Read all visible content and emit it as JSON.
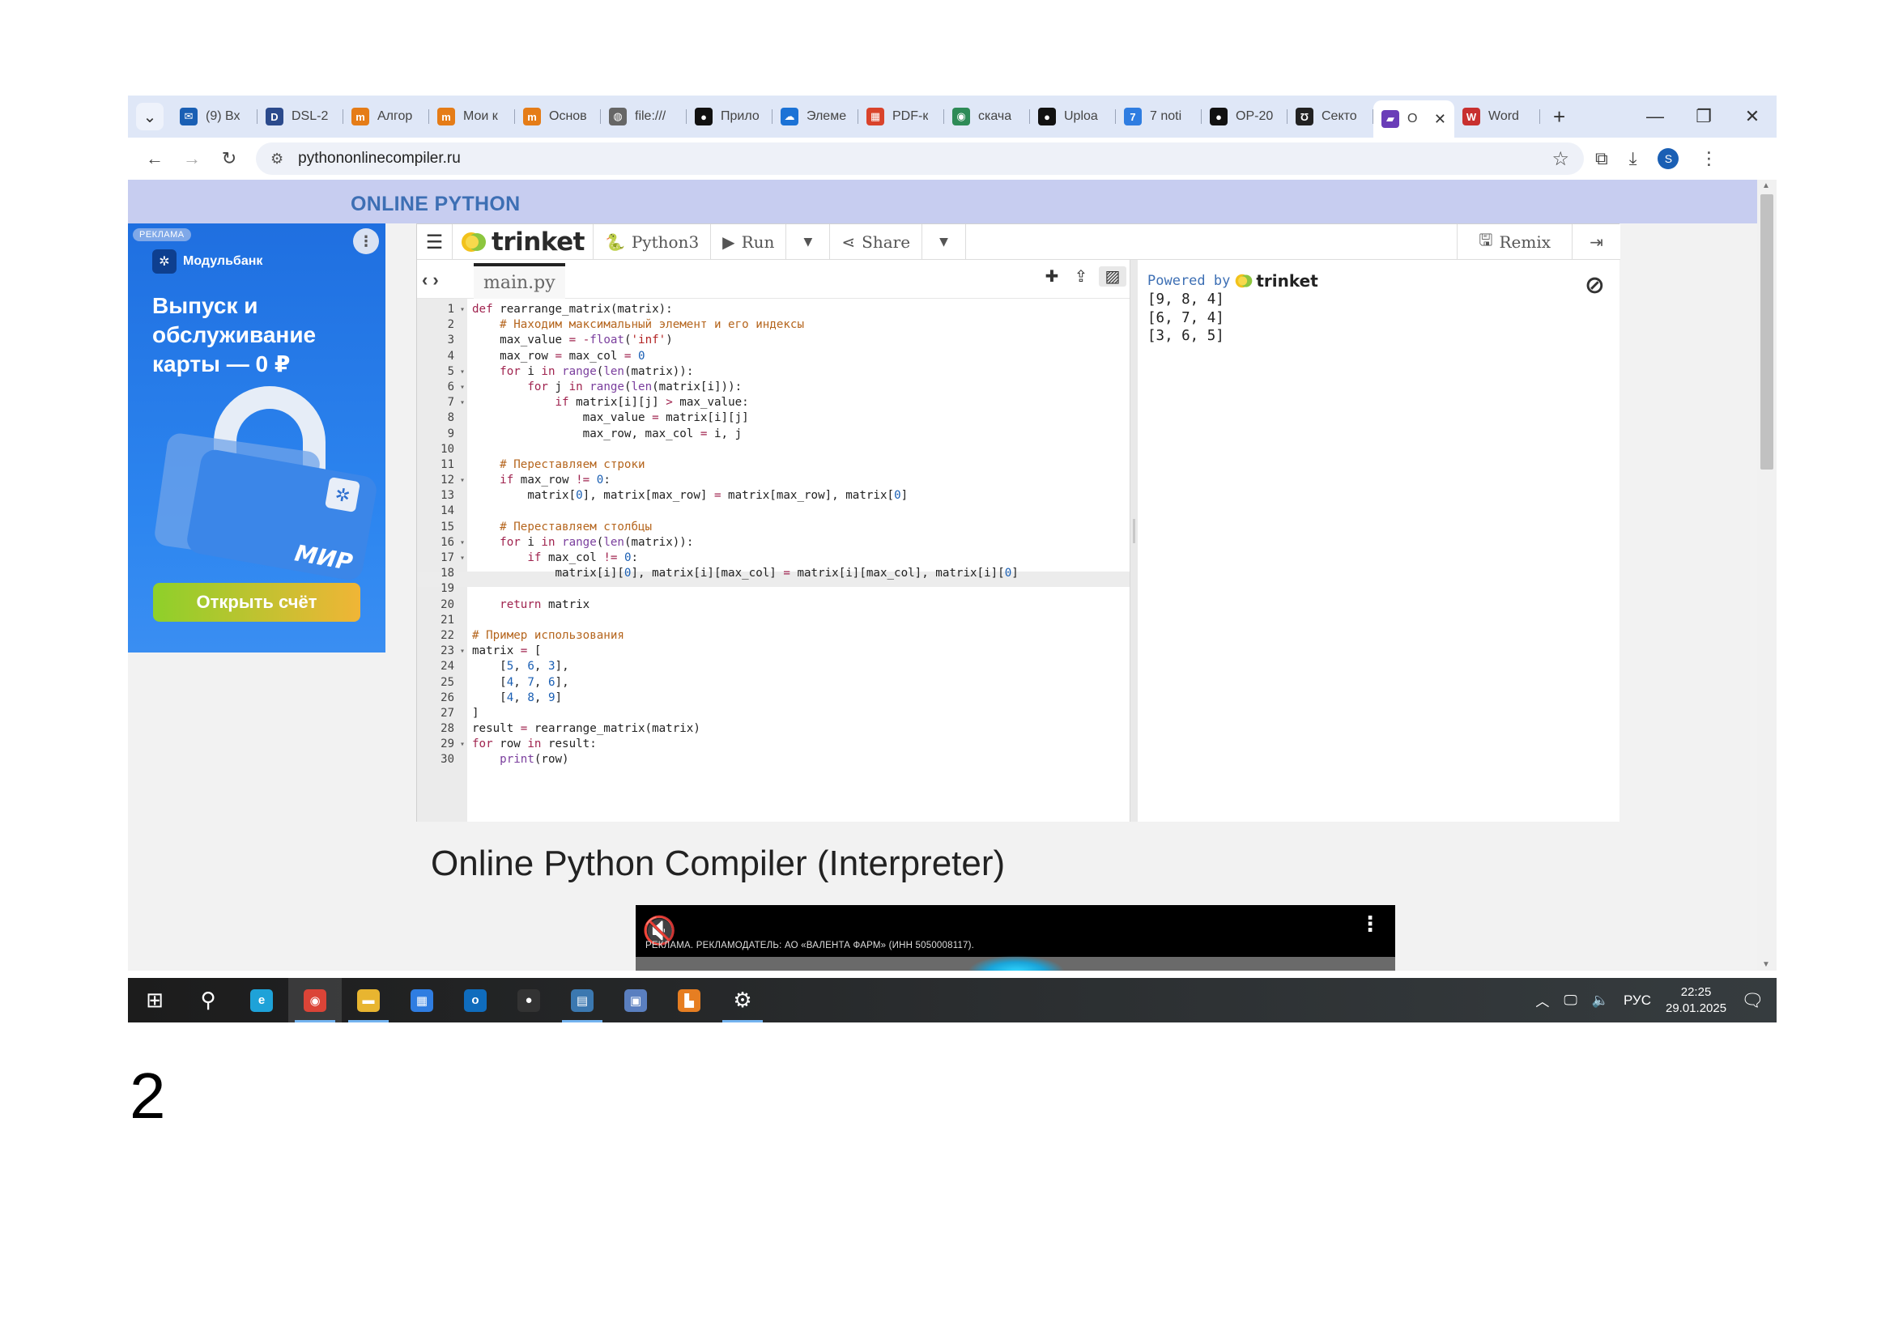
{
  "browser": {
    "tabs": [
      {
        "label": "(9) Вх",
        "icon": "mail-icon",
        "color": "#1a5fb4",
        "glyph": "✉"
      },
      {
        "label": "DSL-2",
        "icon": "dlink-icon",
        "color": "#2b4a8c",
        "glyph": "D"
      },
      {
        "label": "Алгор",
        "icon": "moodle-icon",
        "color": "#e57c17",
        "glyph": "m"
      },
      {
        "label": "Мои к",
        "icon": "moodle-icon",
        "color": "#e57c17",
        "glyph": "m"
      },
      {
        "label": "Основ",
        "icon": "moodle-icon",
        "color": "#e57c17",
        "glyph": "m"
      },
      {
        "label": "file:///",
        "icon": "globe-icon",
        "color": "#666666",
        "glyph": "◍"
      },
      {
        "label": "Прило",
        "icon": "github-icon",
        "color": "#111111",
        "glyph": "●"
      },
      {
        "label": "Элеме",
        "icon": "onedrive-icon",
        "color": "#1b72d6",
        "glyph": "☁"
      },
      {
        "label": "PDF-к",
        "icon": "pdf-icon",
        "color": "#d9432b",
        "glyph": "▦"
      },
      {
        "label": "скача",
        "icon": "download-site-icon",
        "color": "#2e8b57",
        "glyph": "◉"
      },
      {
        "label": "Uploa",
        "icon": "github-icon",
        "color": "#111111",
        "glyph": "●"
      },
      {
        "label": "7 noti",
        "icon": "question-icon",
        "color": "#2f7de1",
        "glyph": "7"
      },
      {
        "label": "OP-20",
        "icon": "github-icon",
        "color": "#111111",
        "glyph": "●"
      },
      {
        "label": "Секто",
        "icon": "sector-icon",
        "color": "#222222",
        "glyph": "Ʊ"
      },
      {
        "label": "O",
        "icon": "trinket-tab-icon",
        "color": "#6a3db8",
        "glyph": "▰",
        "active": true
      },
      {
        "label": "Word",
        "icon": "word-converter-icon",
        "color": "#c8302f",
        "glyph": "W"
      }
    ],
    "url": "pythononlinecompiler.ru",
    "profile_initial": "S"
  },
  "site": {
    "title": "ONLINE PYTHON",
    "heading": "Online Python Compiler (Interpreter)"
  },
  "ad": {
    "tag": "РЕКЛАМА",
    "brand": "Модульбанк",
    "headline": "Выпуск и обслуживание карты — 0 ₽",
    "card_brand": "МИР",
    "cta": "Открыть счёт"
  },
  "trinket": {
    "logo": "trinket",
    "language": "Python3",
    "run": "Run",
    "share": "Share",
    "remix": "Remix",
    "file_tab": "main.py",
    "powered_by": "Powered by",
    "code_lines": [
      "def rearrange_matrix(matrix):",
      "    # Находим максимальный элемент и его индексы",
      "    max_value = -float('inf')",
      "    max_row = max_col = 0",
      "    for i in range(len(matrix)):",
      "        for j in range(len(matrix[i])):",
      "            if matrix[i][j] > max_value:",
      "                max_value = matrix[i][j]",
      "                max_row, max_col = i, j",
      "",
      "    # Переставляем строки",
      "    if max_row != 0:",
      "        matrix[0], matrix[max_row] = matrix[max_row], matrix[0]",
      "",
      "    # Переставляем столбцы",
      "    for i in range(len(matrix)):",
      "        if max_col != 0:",
      "            matrix[i][0], matrix[i][max_col] = matrix[i][max_col], matrix[i][0]",
      "",
      "    return matrix",
      "",
      "# Пример использования",
      "matrix = [",
      "    [5, 6, 3],",
      "    [4, 7, 6],",
      "    [4, 8, 9]",
      "]",
      "result = rearrange_matrix(matrix)",
      "for row in result:",
      "    print(row)"
    ],
    "fold_lines": [
      1,
      5,
      6,
      7,
      12,
      16,
      17,
      23,
      29
    ],
    "active_line": 16,
    "output_lines": [
      "[9, 8, 4]",
      "[6, 7, 4]",
      "[3, 6, 5]"
    ]
  },
  "video_ad": {
    "caption": "РЕКЛАМА. РЕКЛАМОДАТЕЛЬ: АО «ВАЛЕНТА ФАРМ» (ИНН 5050008117)."
  },
  "taskbar": {
    "apps": [
      {
        "name": "start-button",
        "glyph": "⊞",
        "color": ""
      },
      {
        "name": "search-icon",
        "glyph": "⚲",
        "color": ""
      },
      {
        "name": "edge-icon",
        "glyph": "e",
        "color": "#1ea2d8"
      },
      {
        "name": "chrome-icon",
        "glyph": "◉",
        "color": "#db4437",
        "running": true,
        "active": true
      },
      {
        "name": "file-explorer-icon",
        "glyph": "▬",
        "color": "#e8b530",
        "running": true
      },
      {
        "name": "store-icon",
        "glyph": "▦",
        "color": "#2f7de1"
      },
      {
        "name": "outlook-icon",
        "glyph": "o",
        "color": "#0f6cbd"
      },
      {
        "name": "github-desktop-icon",
        "glyph": "●",
        "color": "#333333"
      },
      {
        "name": "python-icon",
        "glyph": "▤",
        "color": "#3b78b0",
        "running": true
      },
      {
        "name": "remote-desktop-icon",
        "glyph": "▣",
        "color": "#5a7fc0"
      },
      {
        "name": "office-icon",
        "glyph": "▙",
        "color": "#e67e22"
      },
      {
        "name": "settings-icon",
        "glyph": "⚙",
        "color": "",
        "running": true
      }
    ],
    "language": "РУС",
    "time": "22:25",
    "date": "29.01.2025"
  },
  "page_number": "2"
}
